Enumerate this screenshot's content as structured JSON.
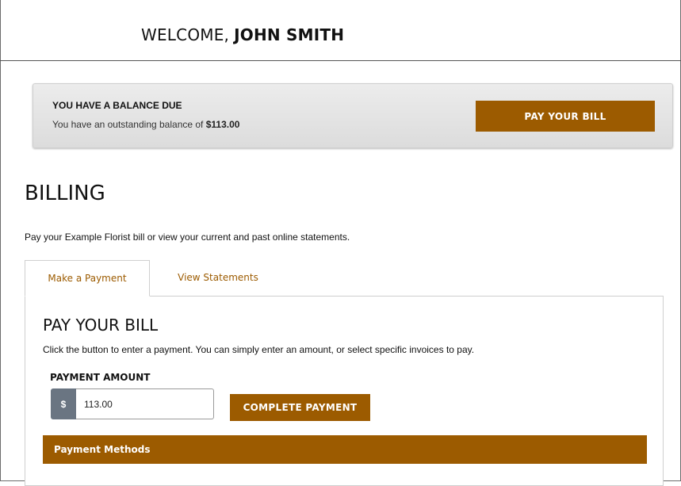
{
  "header": {
    "welcome_label": "WELCOME,",
    "user_name": "JOHN SMITH"
  },
  "balance_notice": {
    "title": "YOU HAVE A BALANCE DUE",
    "text_prefix": "You have an outstanding balance of",
    "amount": "$113.00",
    "pay_button_label": "PAY YOUR BILL"
  },
  "billing": {
    "title": "BILLING",
    "description": "Pay your Example Florist bill or view your current and past online statements."
  },
  "tabs": [
    {
      "label": "Make a Payment",
      "active": true
    },
    {
      "label": "View Statements",
      "active": false
    }
  ],
  "payment_panel": {
    "title": "PAY YOUR BILL",
    "description": "Click the button to enter a payment. You can simply enter an amount, or select specific invoices to pay.",
    "amount_label": "PAYMENT AMOUNT",
    "currency_symbol": "$",
    "amount_value": "113.00",
    "complete_button_label": "COMPLETE PAYMENT",
    "methods_label": "Payment Methods"
  },
  "colors": {
    "accent": "#9c5b00",
    "currency_addon": "#6a7582",
    "notice_bg": "#e4e4e4"
  }
}
